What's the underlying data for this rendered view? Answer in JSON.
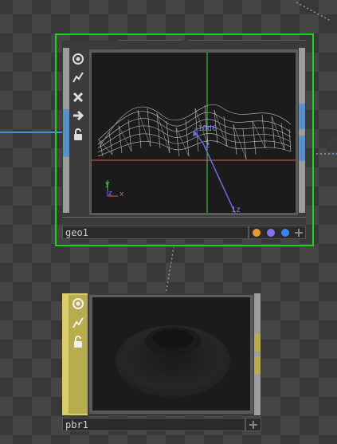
{
  "nodes": {
    "geo": {
      "name": "geo1",
      "viewport_labels": {
        "axis_y": "y",
        "axis_x": "x",
        "axis_z": "z",
        "local_z": "z",
        "far_z": "1z",
        "origin": "-10d0"
      },
      "colors": {
        "selection": "#18d41a",
        "wire": "#bdbdbd",
        "x_axis": "#e05a5a",
        "y_axis": "#4fcf4f",
        "z_axis": "#6a6ae0"
      },
      "badges": [
        {
          "name": "material-badge",
          "color": "#e79a2e"
        },
        {
          "name": "render-badge",
          "color": "#8a6ef0"
        },
        {
          "name": "network-badge",
          "color": "#3a84ee"
        }
      ],
      "side_buttons": [
        "viewer-icon",
        "bypass-icon",
        "cooking-icon",
        "export-icon",
        "lock-icon"
      ]
    },
    "pbr": {
      "name": "pbr1",
      "colors": {
        "family": "#d8cd6a",
        "family_dark": "#a89e45"
      },
      "side_buttons": [
        "viewer-icon",
        "bypass-icon",
        "lock-icon"
      ]
    }
  }
}
